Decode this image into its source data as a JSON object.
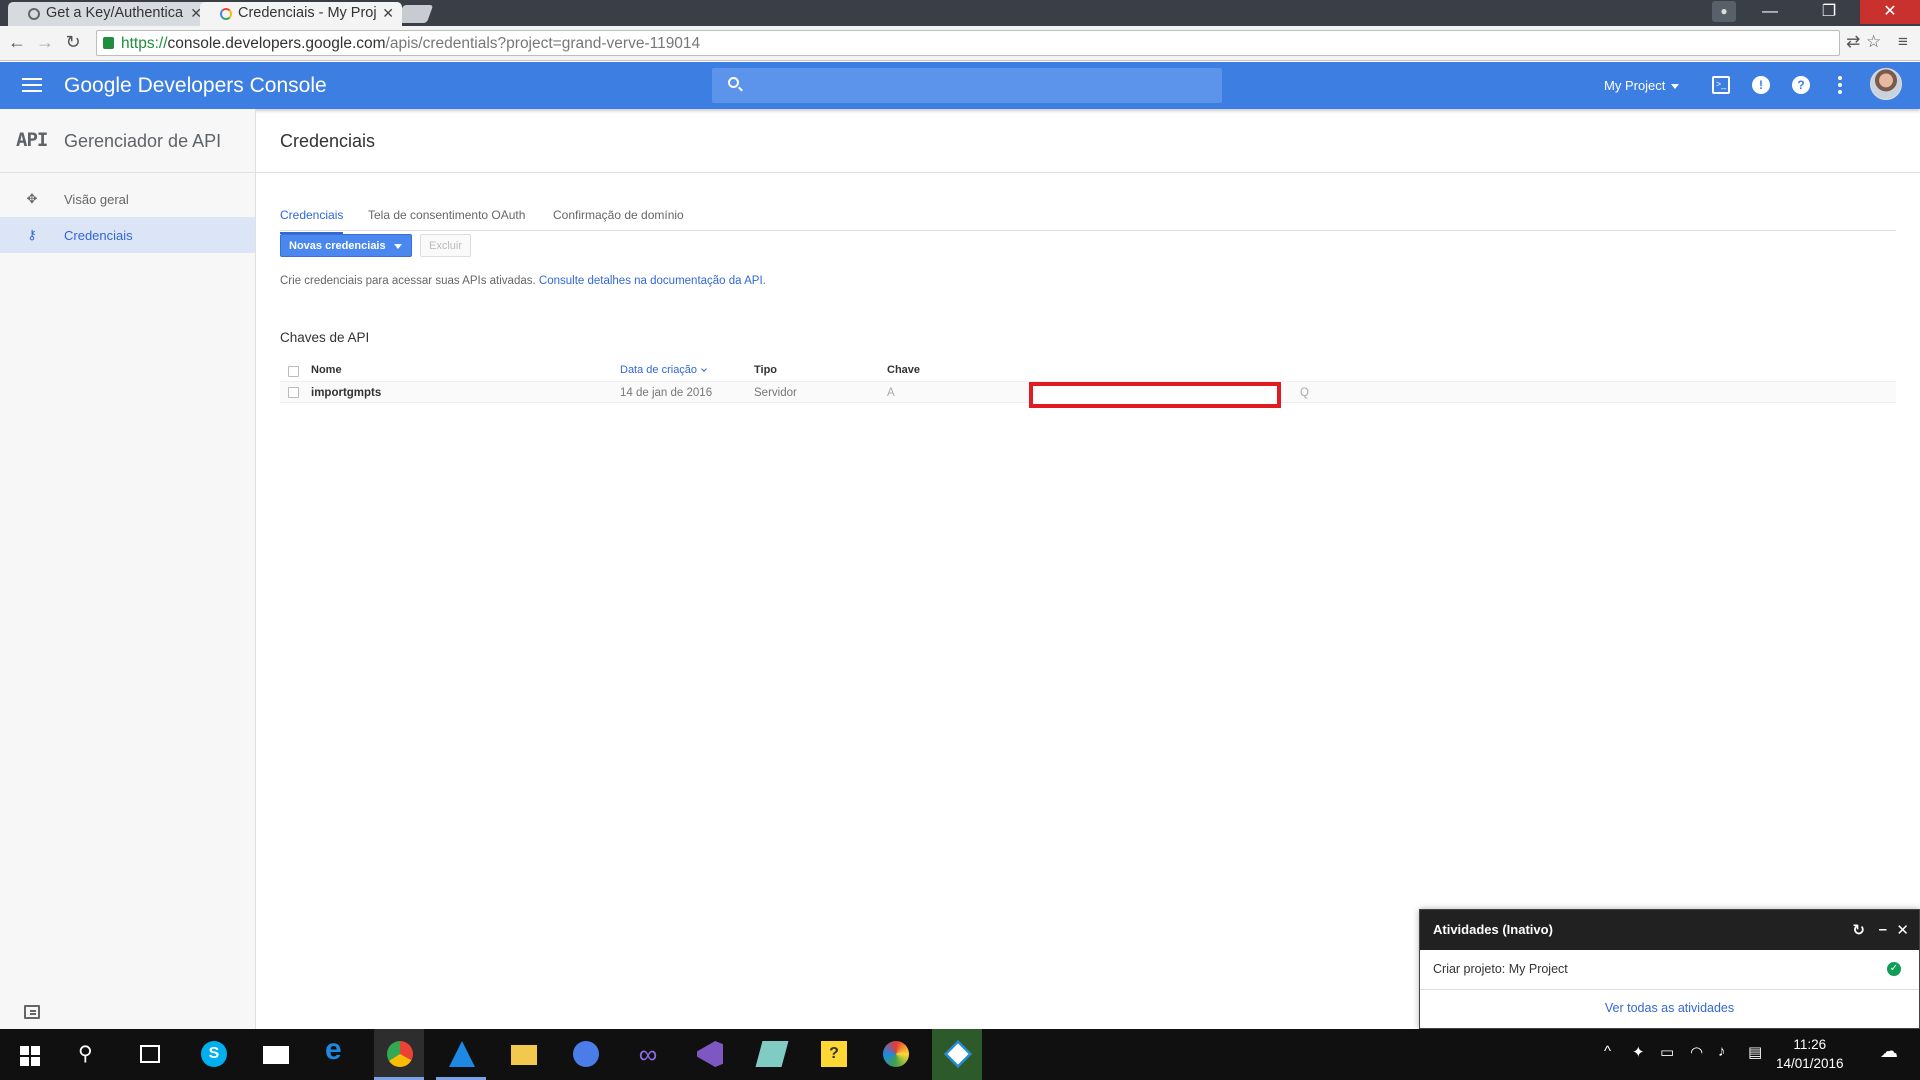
{
  "browser": {
    "tabs": [
      {
        "title": "Get a Key/Authentica",
        "active": false
      },
      {
        "title": "Credenciais - My Proj",
        "active": true
      }
    ],
    "url_scheme": "https://",
    "url_host": "console.developers.google.com",
    "url_path": "/apis/credentials?project=grand-verve-119014",
    "window_controls": {
      "minimize": "—",
      "restore": "❐",
      "close": "✕"
    }
  },
  "header": {
    "brand_google": "Google",
    "brand_product": "Developers Console",
    "project_selector": "My Project",
    "color": "#3d7ee2"
  },
  "sidebar": {
    "logo": "API",
    "title": "Gerenciador de API",
    "items": [
      {
        "label": "Visão geral",
        "icon": "move-icon",
        "active": false
      },
      {
        "label": "Credenciais",
        "icon": "key-icon",
        "active": true
      }
    ]
  },
  "main": {
    "title": "Credenciais",
    "tabs": [
      {
        "label": "Credenciais",
        "active": true
      },
      {
        "label": "Tela de consentimento OAuth",
        "active": false
      },
      {
        "label": "Confirmação de domínio",
        "active": false
      }
    ],
    "new_button": "Novas credenciais",
    "delete_button": "Excluir",
    "intro_text": "Crie credenciais para acessar suas APIs ativadas.",
    "intro_link": "Consulte detalhes na documentação da API.",
    "section_title": "Chaves de API",
    "table": {
      "headers": [
        "Nome",
        "Data de criação",
        "Tipo",
        "Chave"
      ],
      "rows": [
        {
          "name": "importgmpts",
          "created": "14 de jan de 2016",
          "type": "Servidor",
          "key_start": "A",
          "key_end": "Q"
        }
      ]
    }
  },
  "activity": {
    "title": "Atividades (Inativo)",
    "item": "Criar projeto: My Project",
    "footer_link": "Ver todas as atividades"
  },
  "taskbar": {
    "time": "11:26",
    "date": "14/01/2016"
  }
}
